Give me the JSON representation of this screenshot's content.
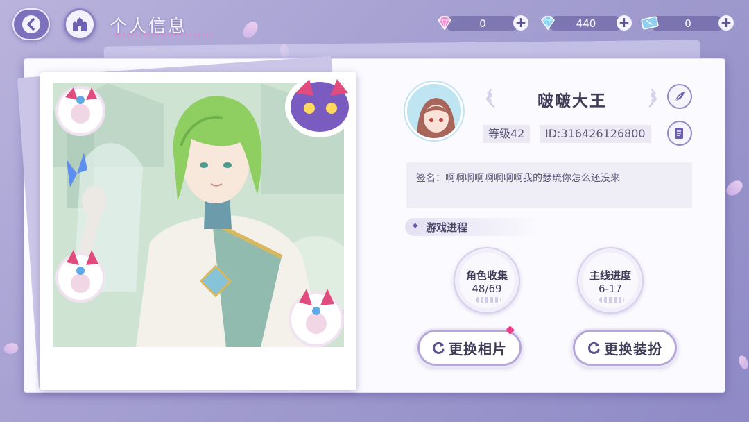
{
  "header": {
    "title": "个人信息",
    "back_icon": "back-arrow-icon",
    "home_icon": "castle-icon"
  },
  "currencies": [
    {
      "icon": "pink-diamond-icon",
      "value": "0"
    },
    {
      "icon": "blue-diamond-icon",
      "value": "440"
    },
    {
      "icon": "ticket-icon",
      "value": "0"
    }
  ],
  "profile": {
    "name": "啵啵大王",
    "level": "等级42",
    "id": "ID:316426126800",
    "signature": "签名：啊啊啊啊啊啊啊啊我的瑟琉你怎么还没来",
    "edit_icon": "feather-quill-icon",
    "records_icon": "document-list-icon"
  },
  "progress": {
    "title": "游戏进程",
    "stats": [
      {
        "label": "角色收集",
        "value": "48/69"
      },
      {
        "label": "主线进度",
        "value": "6-17"
      }
    ]
  },
  "actions": {
    "change_photo": "更换相片",
    "change_outfit": "更换装扮"
  },
  "colors": {
    "accent": "#8c82c4",
    "notification": "#ee3e8a",
    "background": "#a8a2d3"
  }
}
